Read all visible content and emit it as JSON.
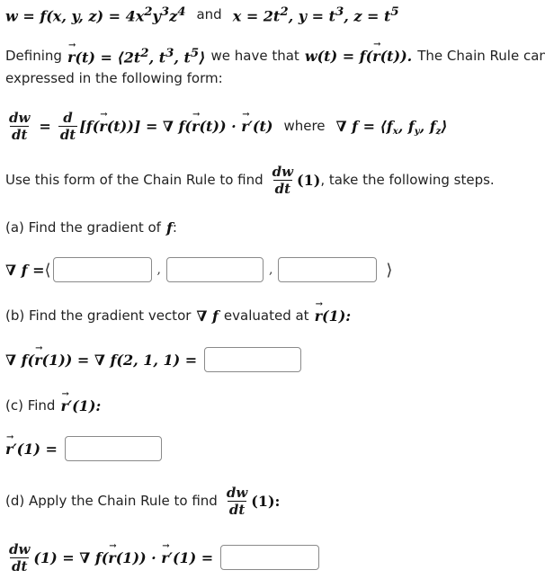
{
  "intro": {
    "definition_math": {
      "lhs": "w = f(x, y, z) = 4x",
      "exp_x": "2",
      "y": "y",
      "exp_y": "3",
      "z": "z",
      "exp_z": "4",
      "and_label": "and",
      "x_def": "x = 2t",
      "x_exp": "2",
      "y_def": ", y = t",
      "y_exp": "3",
      "z_def": ", z = t",
      "z_exp": "5"
    },
    "defining_text": "Defining",
    "r_def_rhs": "(t) = ⟨2t",
    "r_exp1": "2",
    "r_mid1": ", t",
    "r_exp2": "3",
    "r_mid2": ", t",
    "r_exp3": "5",
    "r_close": "⟩",
    "we_have_text": "we have that",
    "w_of_t": "w(t) = f(",
    "w_of_t_close": "(t)).",
    "chain_rule_text": "The Chain Rule can be",
    "expressed_text": "expressed in the following form:"
  },
  "chain_rule": {
    "frac1_num": "dw",
    "frac1_den": "dt",
    "eq": "=",
    "frac2_num": "d",
    "frac2_den": "dt",
    "bracket_expr_open": "[f(",
    "bracket_expr_close": "(t))] = ∇ f(",
    "grad_close": "(t)) · ",
    "r_prime_tail": "′(t)",
    "where_text": "where",
    "grad_def": "∇ f = ⟨f",
    "sub_x": "x",
    "sub_y": "y",
    "sub_z": "z",
    "close": "⟩"
  },
  "instruction": {
    "text_before": "Use this form of the Chain Rule to find",
    "frac_num": "dw",
    "frac_den": "dt",
    "arg": "(1)",
    "text_after": ", take the following steps."
  },
  "part_a": {
    "label": "(a) Find the gradient of",
    "f": "f",
    "colon": ":",
    "lhs": "∇ f = ",
    "open_angle": "⟨",
    "close_angle": "⟩",
    "separator": ",",
    "inputs": [
      {
        "name": "fx",
        "value": ""
      },
      {
        "name": "fy",
        "value": ""
      },
      {
        "name": "fz",
        "value": ""
      }
    ]
  },
  "part_b": {
    "label": "(b) Find the gradient vector",
    "grad": "∇ f",
    "evaluated_at": "evaluated at",
    "r_arg": "(1):",
    "lhs_pre": "∇ f(",
    "lhs_post": "(1)) = ∇ f(2, 1, 1) =",
    "input_value": ""
  },
  "part_c": {
    "label": "(c) Find",
    "r_prime_arg": "′(1):",
    "lhs": "′(1) =",
    "input_value": ""
  },
  "part_d": {
    "label": "(d) Apply the Chain Rule to find",
    "frac_num": "dw",
    "frac_den": "dt",
    "arg": "(1):",
    "lhs_arg": "(1) = ∇ f(",
    "lhs_mid": "(1)) · ",
    "lhs_tail": "′(1) =",
    "input_value": ""
  },
  "vector_symbol": "r"
}
